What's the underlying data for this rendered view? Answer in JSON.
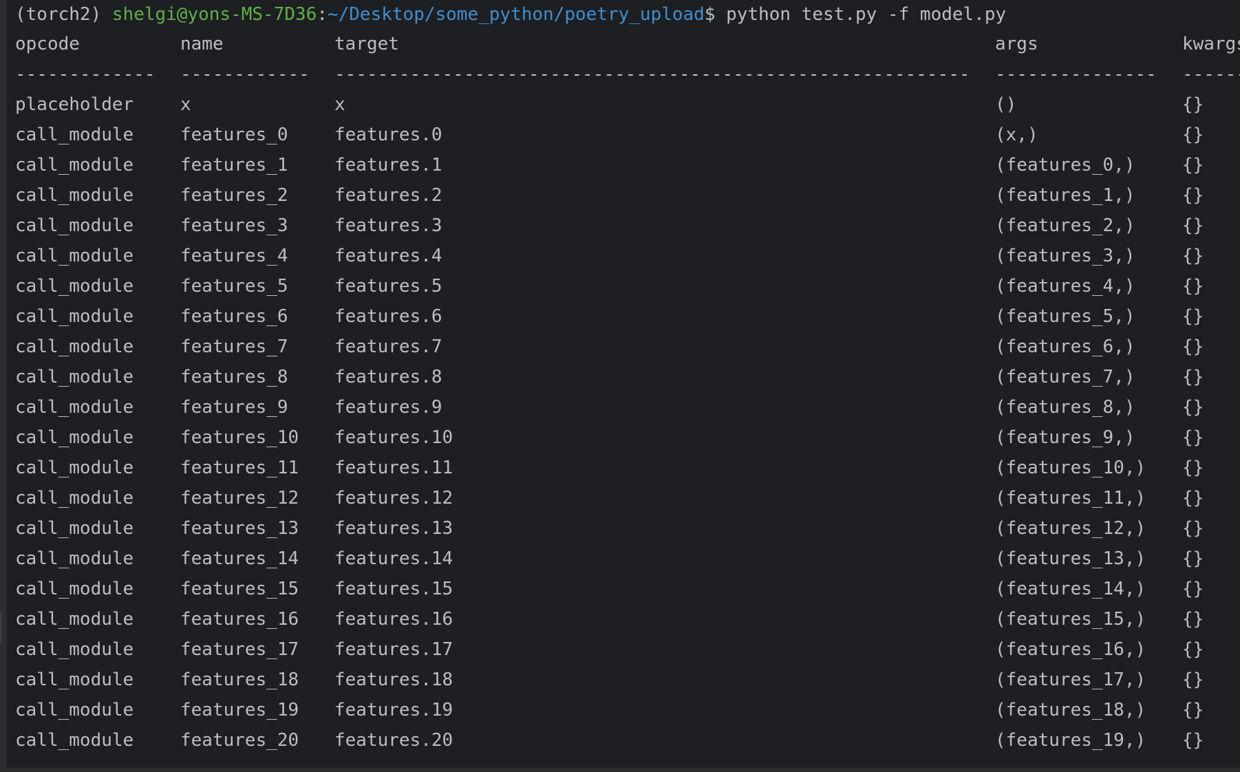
{
  "prompt": {
    "env": "(torch2)",
    "user_host": "shelgi@yons-MS-7D36",
    "separator": ":",
    "path": "~/Desktop/some_python/poetry_upload",
    "dollar": "$",
    "command": "python test.py -f model.py"
  },
  "table": {
    "headers": [
      "opcode",
      "name",
      "target",
      "args",
      "kwargs"
    ],
    "rules": [
      "-------------",
      "------------",
      "-----------------------------------------------------------",
      "---------------",
      "------"
    ],
    "rows": [
      [
        "placeholder",
        "x",
        "x",
        "()",
        "{}"
      ],
      [
        "call_module",
        "features_0",
        "features.0",
        "(x,)",
        "{}"
      ],
      [
        "call_module",
        "features_1",
        "features.1",
        "(features_0,)",
        "{}"
      ],
      [
        "call_module",
        "features_2",
        "features.2",
        "(features_1,)",
        "{}"
      ],
      [
        "call_module",
        "features_3",
        "features.3",
        "(features_2,)",
        "{}"
      ],
      [
        "call_module",
        "features_4",
        "features.4",
        "(features_3,)",
        "{}"
      ],
      [
        "call_module",
        "features_5",
        "features.5",
        "(features_4,)",
        "{}"
      ],
      [
        "call_module",
        "features_6",
        "features.6",
        "(features_5,)",
        "{}"
      ],
      [
        "call_module",
        "features_7",
        "features.7",
        "(features_6,)",
        "{}"
      ],
      [
        "call_module",
        "features_8",
        "features.8",
        "(features_7,)",
        "{}"
      ],
      [
        "call_module",
        "features_9",
        "features.9",
        "(features_8,)",
        "{}"
      ],
      [
        "call_module",
        "features_10",
        "features.10",
        "(features_9,)",
        "{}"
      ],
      [
        "call_module",
        "features_11",
        "features.11",
        "(features_10,)",
        "{}"
      ],
      [
        "call_module",
        "features_12",
        "features.12",
        "(features_11,)",
        "{}"
      ],
      [
        "call_module",
        "features_13",
        "features.13",
        "(features_12,)",
        "{}"
      ],
      [
        "call_module",
        "features_14",
        "features.14",
        "(features_13,)",
        "{}"
      ],
      [
        "call_module",
        "features_15",
        "features.15",
        "(features_14,)",
        "{}"
      ],
      [
        "call_module",
        "features_16",
        "features.16",
        "(features_15,)",
        "{}"
      ],
      [
        "call_module",
        "features_17",
        "features.17",
        "(features_16,)",
        "{}"
      ],
      [
        "call_module",
        "features_18",
        "features.18",
        "(features_17,)",
        "{}"
      ],
      [
        "call_module",
        "features_19",
        "features.19",
        "(features_18,)",
        "{}"
      ],
      [
        "call_module",
        "features_20",
        "features.20",
        "(features_19,)",
        "{}"
      ]
    ]
  }
}
